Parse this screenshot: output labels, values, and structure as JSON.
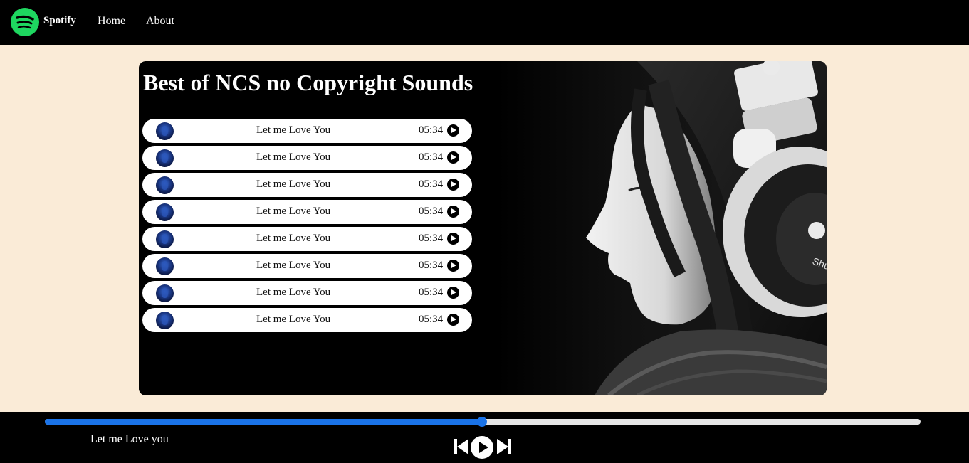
{
  "nav": {
    "brand": "Spotify",
    "links": [
      "Home",
      "About"
    ],
    "logo_icon": "spotify-logo-icon",
    "logo_color": "#1ed760"
  },
  "playlist": {
    "title": "Best of NCS no Copyright Sounds",
    "songs": [
      {
        "name": "Let me Love You",
        "duration": "05:34"
      },
      {
        "name": "Let me Love You",
        "duration": "05:34"
      },
      {
        "name": "Let me Love You",
        "duration": "05:34"
      },
      {
        "name": "Let me Love You",
        "duration": "05:34"
      },
      {
        "name": "Let me Love You",
        "duration": "05:34"
      },
      {
        "name": "Let me Love You",
        "duration": "05:34"
      },
      {
        "name": "Let me Love You",
        "duration": "05:34"
      },
      {
        "name": "Let me Love You",
        "duration": "05:34"
      }
    ]
  },
  "player": {
    "now_playing": "Let me Love you",
    "progress_fraction": 0.499,
    "progress_color": "#1a73e8",
    "controls": [
      "previous-icon",
      "play-icon",
      "next-icon"
    ]
  }
}
